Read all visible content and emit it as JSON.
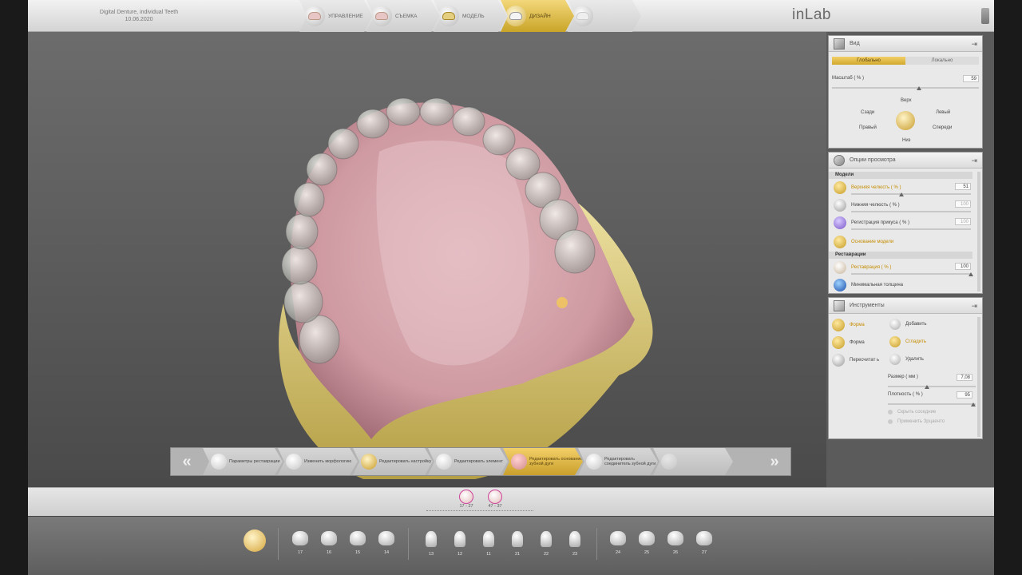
{
  "project": {
    "name": "Digital Denture, individual Teeth",
    "date": "10.06.2020"
  },
  "workflow_steps": [
    {
      "label": "УПРАВЛЕНИЕ",
      "state": "normal"
    },
    {
      "label": "СЪЕМКА",
      "state": "normal"
    },
    {
      "label": "МОДЕЛЬ",
      "state": "normal"
    },
    {
      "label": "ДИЗАЙН",
      "state": "active"
    },
    {
      "label": "",
      "state": "disabled"
    }
  ],
  "brand": {
    "logo": "inLab",
    "watermark": "inLab"
  },
  "view_panel": {
    "title": "Вид",
    "toggle": {
      "option_a": "Глобально",
      "option_b": "Локально",
      "selected": "Глобально"
    },
    "scale_label": "Масштаб ( % )",
    "scale_value": "59",
    "directions": {
      "top": "Верх",
      "back": "Сзади",
      "left": "Левый",
      "right": "Правый",
      "front": "Спереди",
      "bottom": "Низ"
    }
  },
  "view_options_panel": {
    "title": "Опции просмотра",
    "models_header": "Модели",
    "upper_jaw_label": "Верхняя челюсть ( % )",
    "upper_jaw_value": "51",
    "lower_jaw_label": "Нижняя челюсть ( % )",
    "lower_jaw_value": "100",
    "bite_label": "Регистрация прикуса ( % )",
    "bite_value": "100",
    "model_base_label": "Основание модели",
    "restorations_header": "Реставрации",
    "restoration_label": "Реставрация ( % )",
    "restoration_value": "100",
    "min_thickness_label": "Минимальная толщина"
  },
  "tools_panel": {
    "title": "Инструменты",
    "tool_shape_active": "Форма",
    "tool_shape": "Форма",
    "tool_recalc": "Пересчитат ь",
    "op_add": "Добавить",
    "op_smooth": "Сгладить",
    "op_remove": "Удалить",
    "size_label": "Размер ( мм )",
    "size_value": "7,08",
    "density_label": "Плотность ( % )",
    "density_value": "95",
    "hide_contacts": "Скрыть соседние",
    "apply_symmetric": "Применить Зрцаенто"
  },
  "wizard_steps": [
    {
      "label": "Параметры реставрации",
      "state": "normal"
    },
    {
      "label": "Изменить морфологию",
      "state": "normal"
    },
    {
      "label": "Редактировать настройку",
      "state": "normal"
    },
    {
      "label": "Редактировать элемент",
      "state": "normal"
    },
    {
      "label": "Редактировать основание зубной дуги",
      "state": "active"
    },
    {
      "label": "Редактировать соединитель зубной дуги",
      "state": "normal"
    },
    {
      "label": "",
      "state": "disabled"
    }
  ],
  "jaws": [
    {
      "label": "17 - 27"
    },
    {
      "label": "47 - 37"
    }
  ],
  "teeth": [
    "17",
    "16",
    "15",
    "14",
    "13",
    "12",
    "11",
    "21",
    "22",
    "23",
    "24",
    "25",
    "26",
    "27"
  ],
  "colors": {
    "accent_gold": "#d1a82d",
    "gum_pink": "#d7a7ac",
    "model_yellow": "#e2d28a"
  }
}
